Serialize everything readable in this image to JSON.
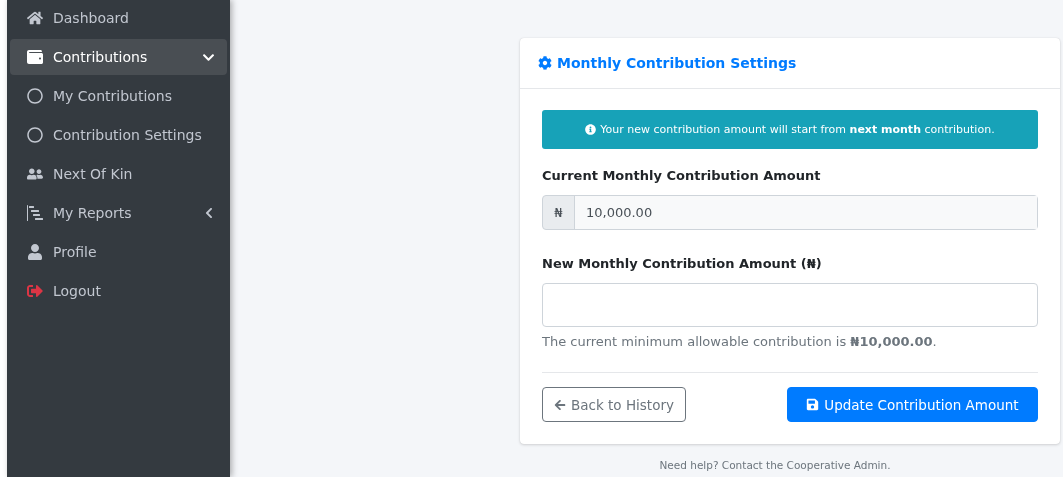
{
  "sidebar": {
    "items": [
      {
        "label": "Dashboard",
        "selected": false
      },
      {
        "label": "Contributions",
        "selected": true,
        "expanded": true,
        "children": [
          {
            "label": "My Contributions",
            "selected": false
          },
          {
            "label": "Contribution Settings",
            "selected": false
          }
        ]
      },
      {
        "label": "Next Of Kin",
        "selected": false
      },
      {
        "label": "My Reports",
        "selected": false,
        "expanded": false
      },
      {
        "label": "Profile",
        "selected": false
      },
      {
        "label": "Logout",
        "selected": false
      }
    ]
  },
  "card": {
    "title": "Monthly Contribution Settings",
    "notice": "Your new contribution amount will start from **next month** contribution.",
    "current": {
      "label": "Current Monthly Contribution Amount",
      "prefix": "₦",
      "value": "10,000.00"
    },
    "new": {
      "label": "New Monthly Contribution Amount (₦)"
    },
    "hint": "The current minimum allowable contribution is **₦10,000.00**.",
    "back": "Back to History",
    "submit": "Update Contribution Amount"
  },
  "footer": "Need help? Contact the Cooperative Admin."
}
